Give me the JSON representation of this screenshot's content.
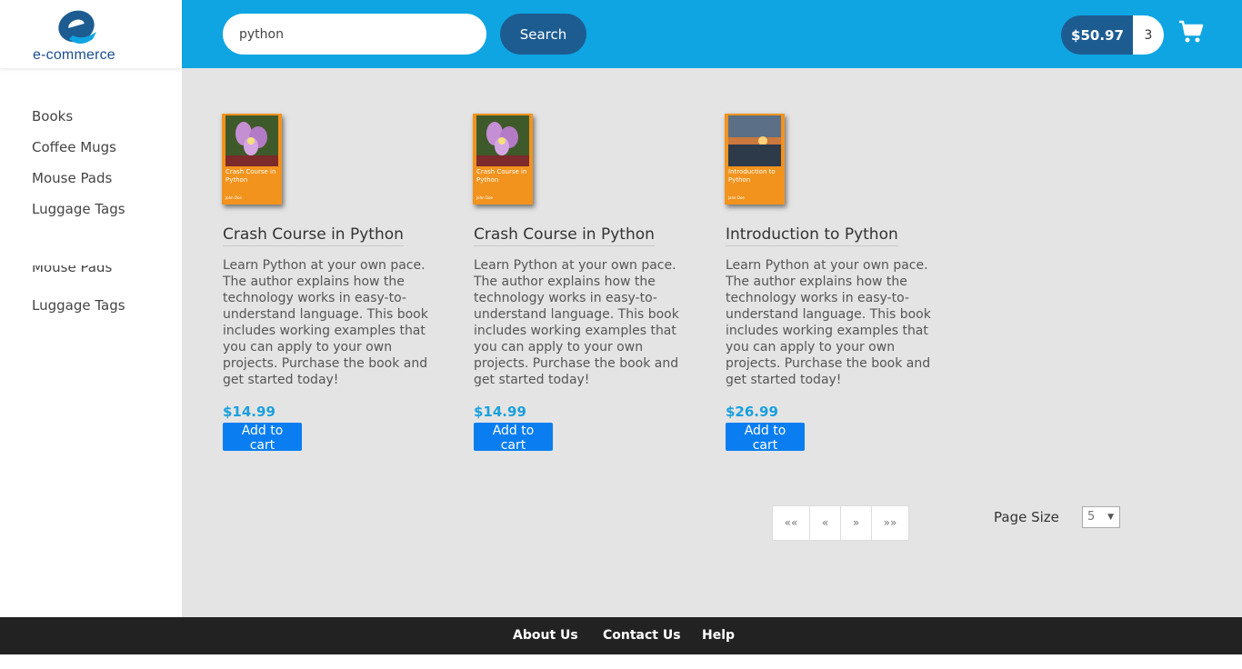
{
  "brand": {
    "logo_text": "e-commerce",
    "accent": "#0ea5e2",
    "dark": "#1d5c91"
  },
  "sidebar": {
    "items": [
      {
        "label": "Books"
      },
      {
        "label": "Coffee Mugs"
      },
      {
        "label": "Mouse Pads"
      },
      {
        "label": "Luggage Tags"
      }
    ],
    "ghost_item": "Mouse Pads",
    "extra_item": "Luggage Tags"
  },
  "header": {
    "search_value": "python",
    "search_button": "Search",
    "cart_total": "$50.97",
    "cart_count": "3"
  },
  "products": [
    {
      "cover_title": "Crash Course in Python",
      "cover_author": "John Doe",
      "cover_image": "flower",
      "name": "Crash Course in Python",
      "description": "Learn Python at your own pace. The author explains how the technology works in easy-to-understand language. This book includes working examples that you can apply to your own projects. Purchase the book and get started today!",
      "price": "$14.99",
      "button": "Add to cart"
    },
    {
      "cover_title": "Crash Course in Python",
      "cover_author": "John Doe",
      "cover_image": "flower",
      "name": "Crash Course in Python",
      "description": "Learn Python at your own pace. The author explains how the technology works in easy-to-understand language. This book includes working examples that you can apply to your own projects. Purchase the book and get started today!",
      "price": "$14.99",
      "button": "Add to cart"
    },
    {
      "cover_title": "Introduction to Python",
      "cover_author": "Jane Doe",
      "cover_image": "sunset",
      "name": "Introduction to Python",
      "description": "Learn Python at your own pace. The author explains how the technology works in easy-to-understand language. This book includes working examples that you can apply to your own projects. Purchase the book and get started today!",
      "price": "$26.99",
      "button": "Add to cart"
    }
  ],
  "pagination": {
    "first": "««",
    "prev": "«",
    "next": "»",
    "last": "»»"
  },
  "page_size": {
    "label": "Page Size",
    "value": "5"
  },
  "footer": {
    "about": "About Us",
    "contact": "Contact Us",
    "help": "Help"
  }
}
